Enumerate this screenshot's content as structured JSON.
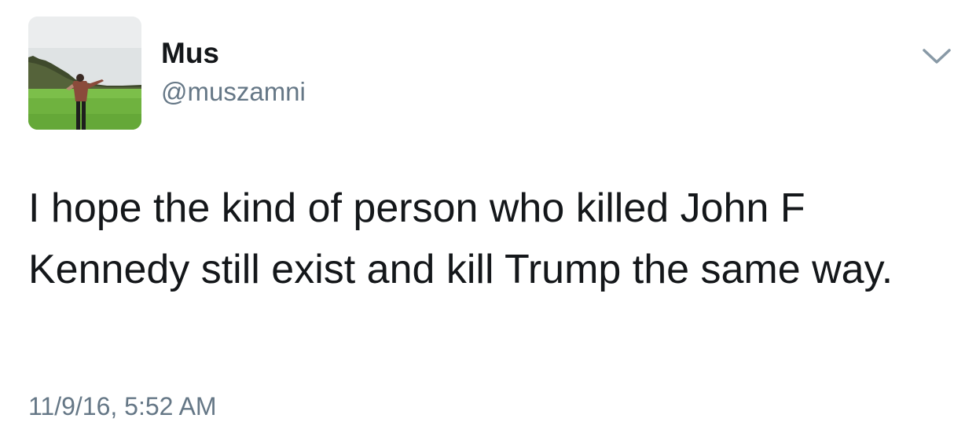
{
  "tweet": {
    "author": {
      "display_name": "Mus",
      "handle": "@muszamni"
    },
    "text": "I hope the kind of person who killed John F Kennedy still exist and kill Trump the same way.",
    "timestamp": "11/9/16, 5:52 AM"
  },
  "icons": {
    "more_menu": "chevron-down-icon",
    "avatar": "profile-photo"
  },
  "colors": {
    "primary_text": "#14171a",
    "secondary_text": "#657786",
    "chevron": "#8899a6",
    "background": "#ffffff"
  }
}
